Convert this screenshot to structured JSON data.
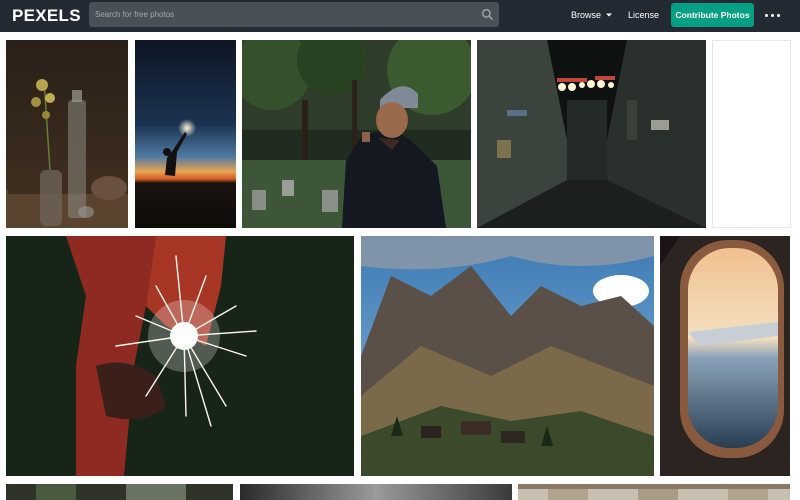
{
  "header": {
    "logo": "PEXELS",
    "search_placeholder": "Search for free photos",
    "browse_label": "Browse",
    "license_label": "License",
    "contribute_label": "Contribute Photos"
  },
  "colors": {
    "header_bg": "#232a34",
    "accent": "#05a081",
    "search_bg": "#4a5058"
  },
  "icons": [
    "search-icon",
    "chevron-down-icon",
    "more-icon"
  ],
  "photos": [
    {
      "name": "still life with bottles and dried flowers"
    },
    {
      "name": "silhouette with sparkler at dusk"
    },
    {
      "name": "man in beanie smoking in park"
    },
    {
      "name": "city alley at night with lights"
    },
    {
      "name": "blank white photo"
    },
    {
      "name": "hand holding sparkler"
    },
    {
      "name": "mountain valley landscape"
    },
    {
      "name": "airplane window at sunset"
    }
  ]
}
